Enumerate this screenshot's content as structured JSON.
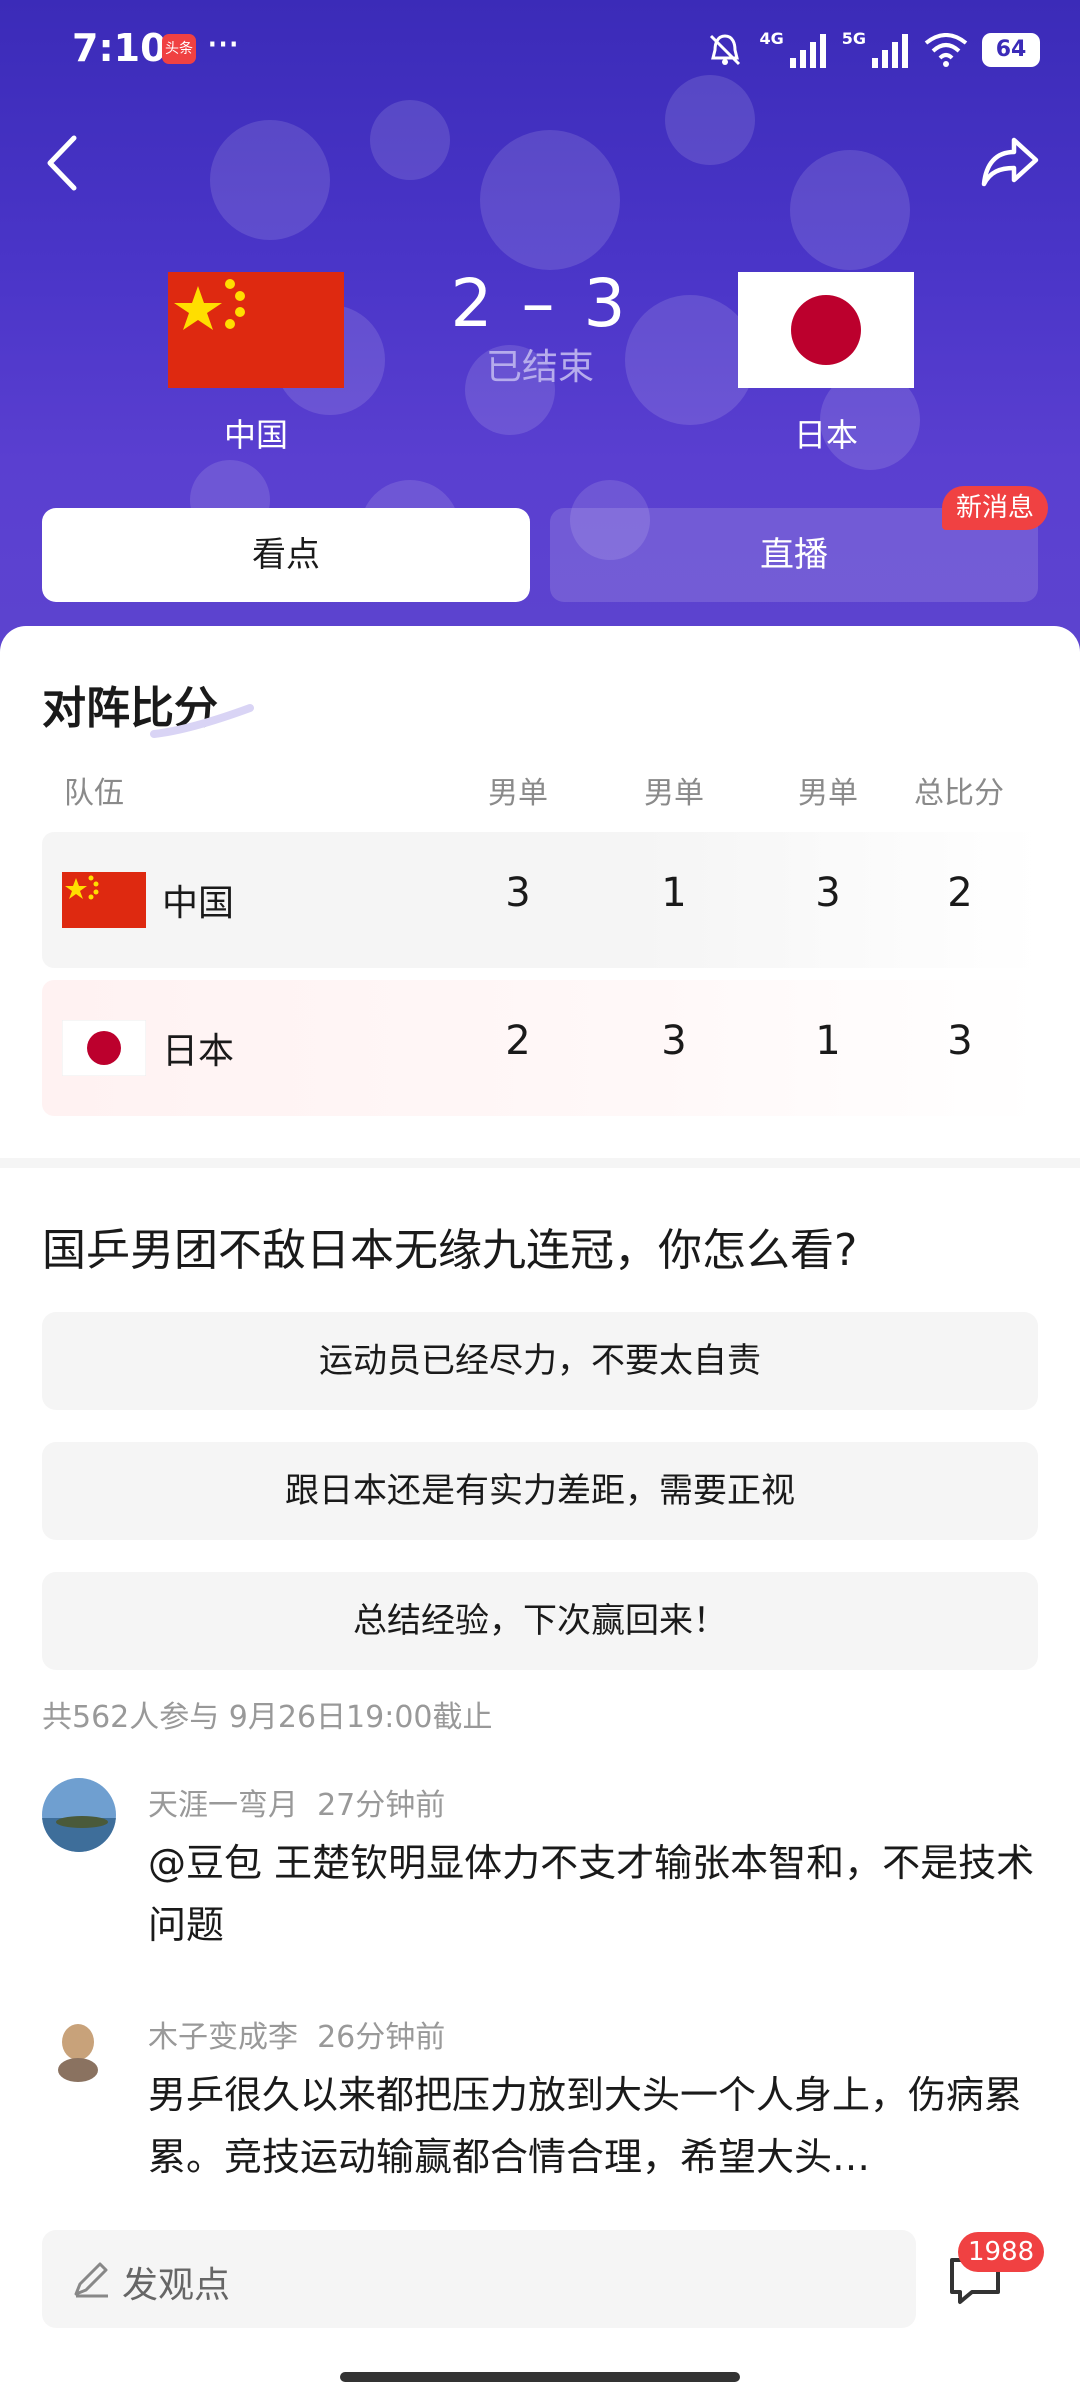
{
  "status_bar": {
    "time": "7:10",
    "app_badge": "头条",
    "dots": "···",
    "net1": "4G",
    "net2": "5G",
    "battery": "64"
  },
  "match": {
    "home": {
      "name": "中国",
      "flag": "china-flag"
    },
    "away": {
      "name": "日本",
      "flag": "japan-flag"
    },
    "score": "2 – 3",
    "status": "已结束"
  },
  "tabs": [
    {
      "label": "看点"
    },
    {
      "label": "直播"
    }
  ],
  "badge_new": "新消息",
  "scoreboard": {
    "title": "对阵比分",
    "headers": [
      "队伍",
      "男单",
      "男单",
      "男单",
      "总比分"
    ],
    "rows": [
      {
        "team": "中国",
        "scores": [
          "3",
          "1",
          "3",
          "2"
        ]
      },
      {
        "team": "日本",
        "scores": [
          "2",
          "3",
          "1",
          "3"
        ]
      }
    ]
  },
  "poll": {
    "question": "国乒男团不敌日本无缘九连冠，你怎么看?",
    "options": [
      "运动员已经尽力，不要太自责",
      "跟日本还是有实力差距，需要正视",
      "总结经验，下次赢回来！"
    ],
    "meta": "共562人参与  9月26日19:00截止"
  },
  "comments": [
    {
      "user": "天涯一弯月",
      "time": "27分钟前",
      "text": "@豆包 王楚钦明显体力不支才输张本智和，不是技术问题"
    },
    {
      "user": "木子变成李",
      "time": "26分钟前",
      "text": "男乒很久以来都把压力放到大头一个人身上，伤病累累。竞技运动输赢都合情合理，希望大头…"
    }
  ],
  "bottom": {
    "placeholder": "发观点",
    "comment_count": "1988"
  },
  "colors": {
    "hero": "#4a35c8",
    "accent_red": "#f04142",
    "china_red": "#de2910",
    "japan_red": "#bc002d"
  }
}
